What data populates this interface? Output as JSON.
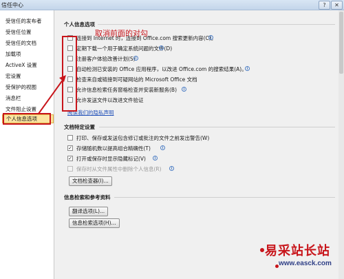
{
  "window": {
    "title": "信任中心"
  },
  "sidebar": {
    "items": [
      {
        "label": "受信任的发布者"
      },
      {
        "label": "受信任位置"
      },
      {
        "label": "受信任的文档"
      },
      {
        "label": "加载项"
      },
      {
        "label": "ActiveX 设置"
      },
      {
        "label": "宏设置"
      },
      {
        "label": "受保护的视图"
      },
      {
        "label": "消息栏"
      },
      {
        "label": "文件阻止设置"
      },
      {
        "label": "个人信息选项"
      }
    ],
    "selected_index": 9
  },
  "privacy": {
    "title": "个人信息选项",
    "options": [
      {
        "label": "连接到 Internet 时，连接到 Office.com 搜索更新内容(C)。",
        "checked": false
      },
      {
        "label": "定期下载一个用于确定系统问题的文件(D)",
        "checked": false
      },
      {
        "label": "注册客户体验改善计划(S)",
        "checked": false
      },
      {
        "label": "自动检测已安装的 Office 应用程序，以改进 Office.com 的搜索结果(A)。",
        "checked": false
      },
      {
        "label": "检查来自或链接到可疑网站的 Microsoft Office 文档",
        "checked": false
      },
      {
        "label": "允许信息检索任务窗格检查并安装新服务(B)",
        "checked": false
      },
      {
        "label": "允许发送文件以改进文件验证",
        "checked": false
      }
    ],
    "privacy_link": "阅读我们的隐私声明"
  },
  "annotation": {
    "text": "取消前面的对勾"
  },
  "doc_options": {
    "title": "文档特定设置",
    "options": [
      {
        "label": "打印、保存或发送包含修订或批注的文件之前发出警告(W)",
        "checked": false,
        "disabled": false
      },
      {
        "label": "存储随机数以提高组合精确性(T)",
        "checked": true,
        "disabled": false
      },
      {
        "label": "打开或保存时显示隐藏标记(V)",
        "checked": true,
        "disabled": false
      },
      {
        "label": "保存时从文件属性中删除个人信息(R)",
        "checked": false,
        "disabled": true
      }
    ],
    "inspector_button": "文档检查器(I)..."
  },
  "research": {
    "title": "信息检索和参考资料",
    "translate_button": "翻译选项(L)...",
    "research_button": "信息检索选项(H)..."
  },
  "watermark": {
    "text": "易采站长站",
    "url": "www.easck.com"
  },
  "colors": {
    "annotation_red": "#c8151b",
    "selected_bg": "#fbe4a0",
    "link_blue": "#1f4fb8"
  }
}
